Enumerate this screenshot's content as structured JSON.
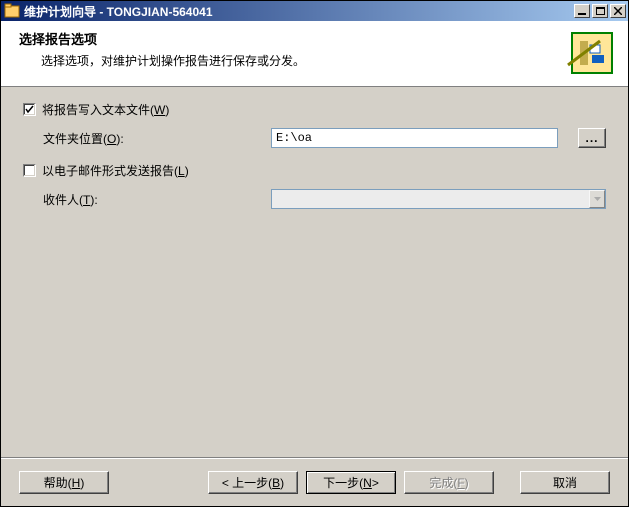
{
  "window": {
    "title": "维护计划向导 - TONGJIAN-564041"
  },
  "header": {
    "title": "选择报告选项",
    "desc": "选择选项，对维护计划操作报告进行保存或分发。"
  },
  "options": {
    "writeToFile": {
      "label_pre": "将报告写入文本文件(",
      "accel": "W",
      "label_post": ")",
      "checked": true,
      "folderLabel_pre": "文件夹位置(",
      "folderAccel": "O",
      "folderLabel_post": "):",
      "folderValue": "E:\\oa"
    },
    "emailReport": {
      "label_pre": "以电子邮件形式发送报告(",
      "accel": "L",
      "label_post": ")",
      "checked": false,
      "recipientLabel_pre": "收件人(",
      "recipientAccel": "T",
      "recipientLabel_post": "):",
      "recipientValue": ""
    }
  },
  "buttons": {
    "help_pre": "帮助(",
    "help_accel": "H",
    "help_post": ")",
    "back_pre": "< 上一步(",
    "back_accel": "B",
    "back_post": ")",
    "next_pre": "下一步(",
    "next_accel": "N",
    "next_post": " >",
    "finish_pre": "完成(",
    "finish_accel": "F",
    "finish_post": ")",
    "cancel": "取消",
    "browse": "..."
  }
}
